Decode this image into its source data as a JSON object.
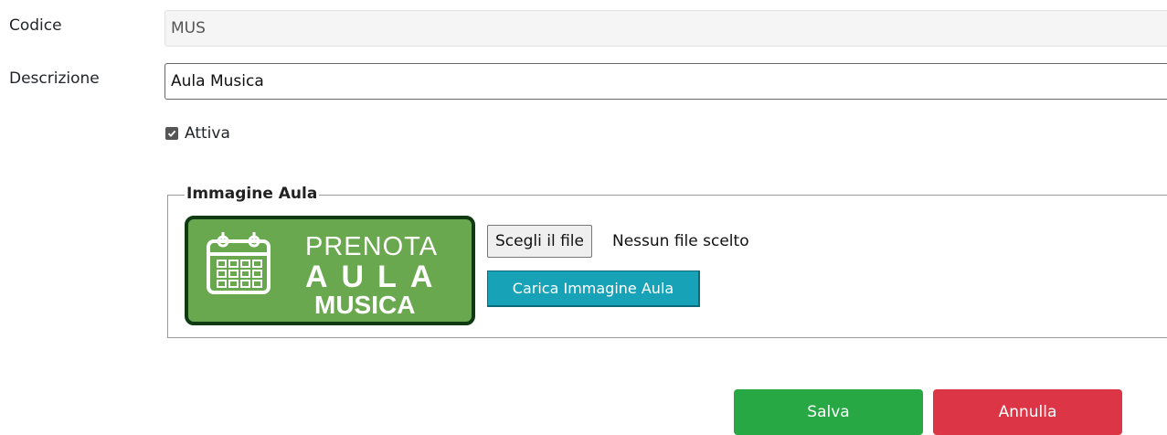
{
  "form": {
    "codice_label": "Codice",
    "codice_value": "MUS",
    "descrizione_label": "Descrizione",
    "descrizione_value": "Aula Musica",
    "attiva_label": "Attiva",
    "attiva_checked": true
  },
  "image_section": {
    "legend": "Immagine Aula",
    "logo": {
      "line1": "PRENOTA",
      "line2": "AULA",
      "line3": "MUSICA",
      "icon": "calendar-icon"
    },
    "file_button_label": "Scegli il file",
    "file_status": "Nessun file scelto",
    "upload_button_label": "Carica Immagine Aula"
  },
  "actions": {
    "save_label": "Salva",
    "cancel_label": "Annulla"
  },
  "colors": {
    "save": "#28a745",
    "cancel": "#dc3545",
    "upload": "#17a2b8",
    "logo_bg": "#6aa84f",
    "logo_border": "#0f3a12"
  }
}
